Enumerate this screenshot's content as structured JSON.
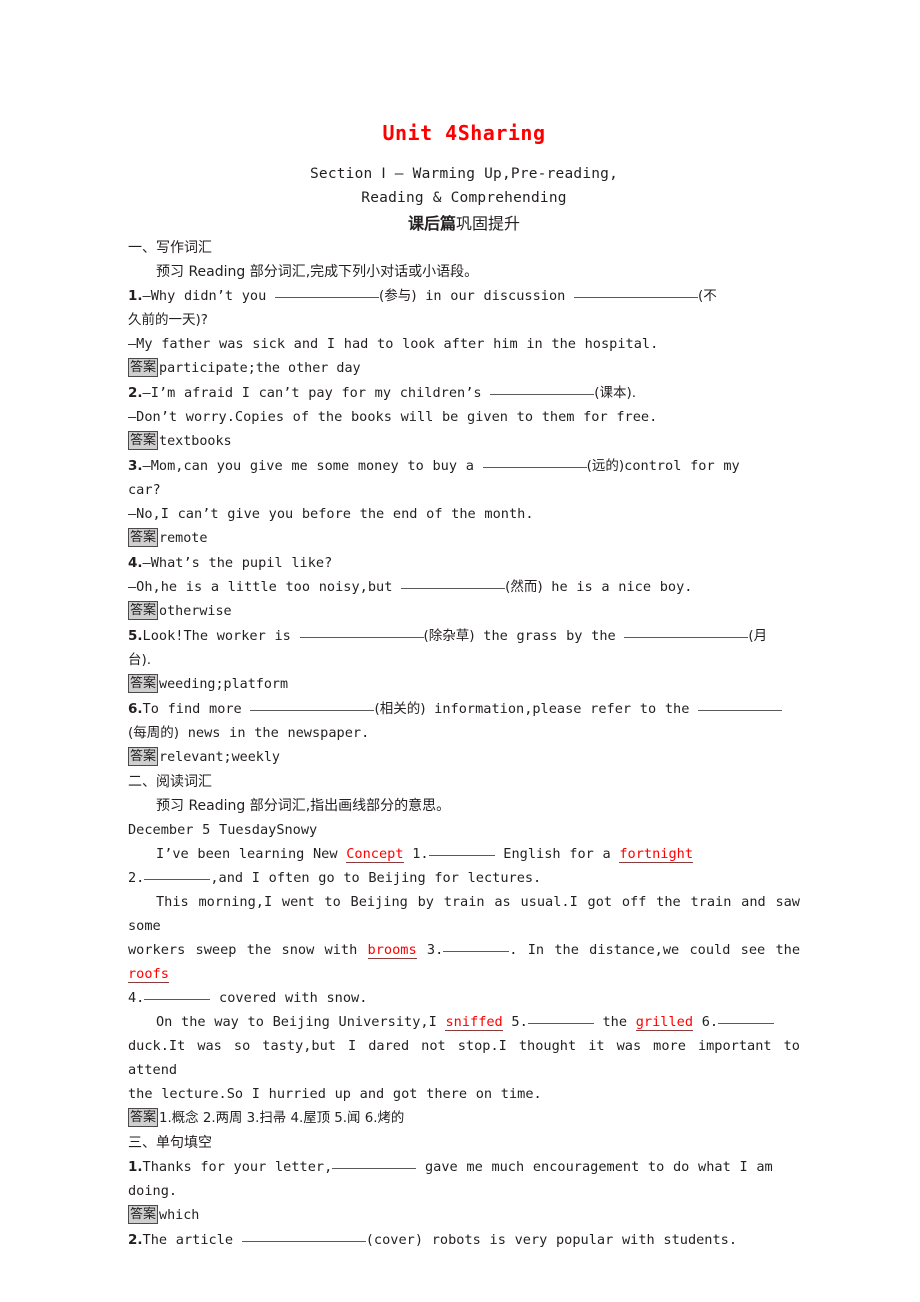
{
  "document": {
    "unit_title": "Unit 4Sharing",
    "section_line_1": "Section Ⅰ — Warming Up,Pre-reading,",
    "section_line_2": "Reading & Comprehending",
    "banner_bold": "课后篇",
    "banner_rest": "巩固提升",
    "answer_tag": "答案"
  },
  "part1": {
    "heading": "一、写作词汇",
    "instruction": "预习 Reading 部分词汇,完成下列小对话或小语段。",
    "items": [
      {
        "number": "1.",
        "q_before": "—Why didn’t you ",
        "hint1": "(参与)",
        "mid": " in our discussion ",
        "hint2": "(不",
        "wrap": "久前的一天)?",
        "reply": "—My father was sick and I had to look after him in the hospital.",
        "answer": "participate;the other day"
      },
      {
        "number": "2.",
        "q_before": "—I’m afraid I can’t pay for my children’s ",
        "hint1": "(课本).",
        "reply": "—Don’t worry.Copies of the books will be given to them for free.",
        "answer": "textbooks"
      },
      {
        "number": "3.",
        "q_before": "—Mom,can you give me some money to buy a ",
        "hint1": "(远的)",
        "mid": "control for my",
        "wrap": "car?",
        "reply": "—No,I can’t give you before the end of the month.",
        "answer": "remote"
      },
      {
        "number": "4.",
        "q_before": "—What’s the pupil like?",
        "reply_before": "—Oh,he is a little too noisy,but ",
        "hint1": "(然而)",
        "reply_after": " he is a nice boy.",
        "answer": "otherwise"
      },
      {
        "number": "5.",
        "q_before": "Look!The worker is ",
        "hint1": "(除杂草)",
        "mid": " the grass by the ",
        "hint2": "(月",
        "wrap": "台).",
        "answer": "weeding;platform"
      },
      {
        "number": "6.",
        "q_before": "To find more ",
        "hint1": "(相关的)",
        "mid": " information,please refer to the ",
        "wrap_hint": "(每周的)",
        "wrap": " news in the newspaper.",
        "answer": "relevant;weekly"
      }
    ]
  },
  "part2": {
    "heading": "二、阅读词汇",
    "instruction": "预习 Reading 部分词汇,指出画线部分的意思。",
    "date_line": "December 5  TuesdaySnowy",
    "passage": {
      "l1_a": "I’ve been learning New ",
      "l1_vocab": "Concept",
      "l1_b": " 1.",
      "l1_c": " English for a ",
      "l1_vocab2": "fortnight",
      "l2_a": "2.",
      "l2_b": ",and I often go to Beijing for lectures.",
      "l3": "This morning,I went to Beijing by train as usual.I got off the train and saw some",
      "l4_a": "workers sweep the snow with ",
      "l4_vocab": "brooms",
      "l4_b": " 3.",
      "l4_c": ". In the distance,we could see the ",
      "l4_vocab2": "roofs",
      "l5_a": "4.",
      "l5_b": " covered with snow.",
      "l6_a": "On the way to Beijing University,I ",
      "l6_vocab": "sniffed",
      "l6_b": " 5.",
      "l6_c": " the ",
      "l6_vocab2": "grilled",
      "l6_d": " 6.",
      "l7": "duck.It was so tasty,but I dared not stop.I thought it was more important to attend",
      "l8": "the lecture.So I hurried up and got there on time."
    },
    "answer": "1.概念  2.两周  3.扫帚  4.屋顶  5.闻  6.烤的"
  },
  "part3": {
    "heading": "三、单句填空",
    "items": [
      {
        "number": "1.",
        "before": "Thanks for your letter,",
        "after": " gave me much encouragement to do what I am",
        "wrap": "doing.",
        "answer": "which"
      },
      {
        "number": "2.",
        "before": "The article ",
        "hint": "(cover)",
        "after": " robots is very popular with students."
      }
    ]
  },
  "colors": {
    "title_red": "#ff0000",
    "vocab_red": "#ff0000",
    "answer_tag_bg": "#cfcfcf",
    "text": "#231f20"
  }
}
